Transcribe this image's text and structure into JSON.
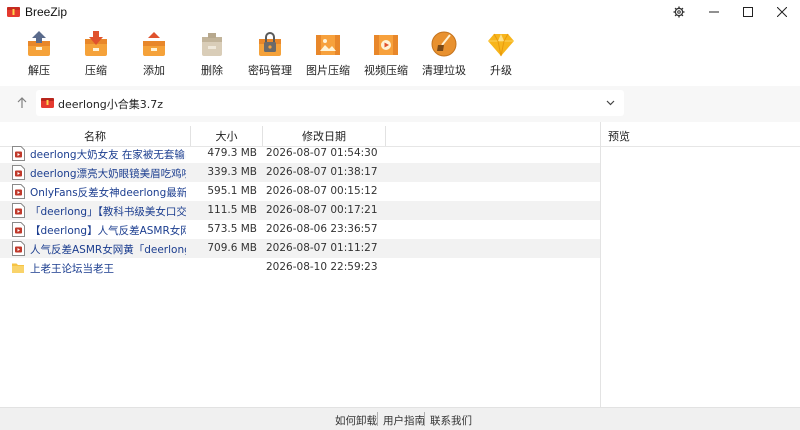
{
  "window": {
    "title": "BreeZip",
    "controls": [
      "settings-icon",
      "minimize-icon",
      "maximize-icon",
      "close-icon"
    ]
  },
  "toolbar": {
    "items": [
      {
        "label": "解压",
        "icon": "extract-box-icon"
      },
      {
        "label": "压缩",
        "icon": "compress-box-icon"
      },
      {
        "label": "添加",
        "icon": "add-box-icon"
      },
      {
        "label": "删除",
        "icon": "delete-box-icon"
      },
      {
        "label": "密码管理",
        "icon": "password-lock-icon"
      },
      {
        "label": "图片压缩",
        "icon": "image-compress-icon"
      },
      {
        "label": "视频压缩",
        "icon": "video-compress-icon"
      },
      {
        "label": "清理垃圾",
        "icon": "broom-clean-icon"
      },
      {
        "label": "升级",
        "icon": "diamond-icon"
      }
    ]
  },
  "address": {
    "path": "deerlong小合集3.7z"
  },
  "file_list": {
    "columns": [
      "名称",
      "大小",
      "修改日期"
    ],
    "rows": [
      {
        "name": "deerlong大奶女友 在家被无套输出 内射",
        "size": "479.3 MB",
        "date": "2026-08-07 01:54:30",
        "type": "video"
      },
      {
        "name": "deerlong漂亮大奶眼镜美眉吃鸡啪啪在浴",
        "size": "339.3 MB",
        "date": "2026-08-07 01:38:17",
        "type": "video"
      },
      {
        "name": "OnlyFans反差女神deerlong最新视频流出",
        "size": "595.1 MB",
        "date": "2026-08-07 00:15:12",
        "type": "video"
      },
      {
        "name": "「deerlong」【教科书级美女口交教学】",
        "size": "111.5 MB",
        "date": "2026-08-07 00:17:21",
        "type": "video"
      },
      {
        "name": "【deerlong】人气反差ASMR女网黄 裸聊",
        "size": "573.5 MB",
        "date": "2026-08-06 23:36:57",
        "type": "video"
      },
      {
        "name": "人气反差ASMR女网黄「deerlong」OF付费",
        "size": "709.6 MB",
        "date": "2026-08-07 01:11:27",
        "type": "video"
      },
      {
        "name": "上老王论坛当老王",
        "size": "",
        "date": "2026-08-10 22:59:23",
        "type": "folder"
      }
    ]
  },
  "preview": {
    "title": "预览"
  },
  "footer": {
    "links": [
      "如何卸载",
      "用户指南",
      "联系我们"
    ]
  }
}
